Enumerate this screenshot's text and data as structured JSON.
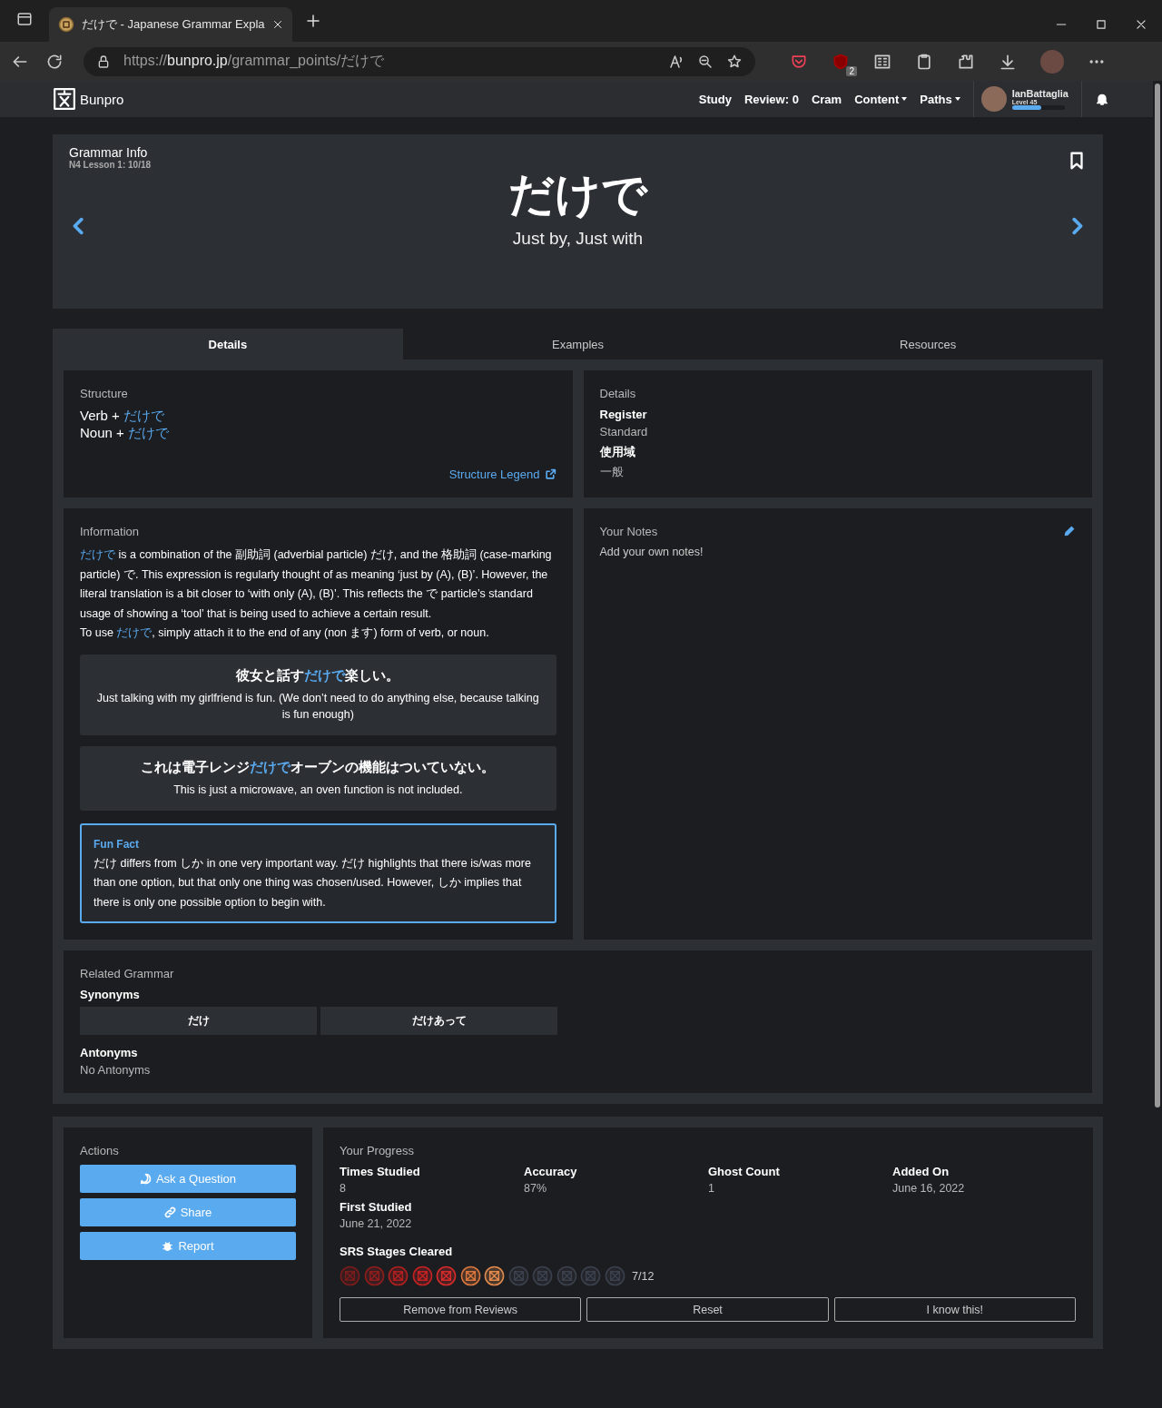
{
  "browser": {
    "tab_title": "だけで - Japanese Grammar Expla",
    "url_scheme": "https://",
    "url_host": "bunpro.jp",
    "url_path": "/grammar_points/だけで",
    "extension_badge": "2"
  },
  "nav": {
    "brand": "Bunpro",
    "items": [
      {
        "label": "Study",
        "dropdown": false
      },
      {
        "label": "Review: 0",
        "dropdown": false
      },
      {
        "label": "Cram",
        "dropdown": false
      },
      {
        "label": "Content",
        "dropdown": true
      },
      {
        "label": "Paths",
        "dropdown": true
      }
    ],
    "user": {
      "name": "IanBattaglia",
      "level_text": "Level 45",
      "level": 0.55
    }
  },
  "header": {
    "title": "Grammar Info",
    "lesson": "N4 Lesson 1: 10/18",
    "grammar": "だけで",
    "meaning": "Just by, Just with"
  },
  "tabs": [
    {
      "label": "Details",
      "selected": true
    },
    {
      "label": "Examples",
      "selected": false
    },
    {
      "label": "Resources",
      "selected": false
    }
  ],
  "structure": {
    "title": "Structure",
    "lines": [
      {
        "prefix": "Verb + ",
        "grammar": "だけで"
      },
      {
        "prefix": "Noun + ",
        "grammar": "だけで"
      }
    ],
    "legend_link": "Structure Legend"
  },
  "details": {
    "title": "Details",
    "items": [
      {
        "label": "Register",
        "value": "Standard"
      },
      {
        "label": "使用域",
        "value": "一般"
      }
    ]
  },
  "information": {
    "title": "Information",
    "paragraphs": [
      [
        {
          "text": "だけで",
          "highlight": true
        },
        {
          "text": " is a combination of the 副助詞 (adverbial particle) だけ, and the 格助詞 (case-marking particle) で. This expression is regularly thought of as meaning ‘just by (A), (B)’. However, the literal translation is a bit closer to ‘with only (A), (B)’. This reflects the で particle’s standard usage of showing a ‘tool’ that is being used to achieve a certain result.",
          "highlight": false
        }
      ],
      [
        {
          "text": "To use ",
          "highlight": false
        },
        {
          "text": "だけで",
          "highlight": true
        },
        {
          "text": ", simply attach it to the end of any (non ます) form of verb, or noun.",
          "highlight": false
        }
      ]
    ],
    "examples": [
      {
        "japanese": [
          {
            "text": "彼女と話す",
            "highlight": false
          },
          {
            "text": "だけで",
            "highlight": true
          },
          {
            "text": "楽しい。",
            "highlight": false
          }
        ],
        "english": "Just talking with my girlfriend is fun. (We don’t need to do anything else, because talking is fun enough)"
      },
      {
        "japanese": [
          {
            "text": "これは電子レンジ",
            "highlight": false
          },
          {
            "text": "だけで",
            "highlight": true
          },
          {
            "text": "オーブンの機能はついていない。",
            "highlight": false
          }
        ],
        "english": "This is just a microwave, an oven function is not included."
      }
    ],
    "fun_fact": {
      "title": "Fun Fact",
      "text": "だけ differs from しか in one very important way. だけ highlights that there is/was more than one option, but that only one thing was chosen/used. However, しか implies that there is only one possible option to begin with."
    }
  },
  "notes": {
    "title": "Your Notes",
    "placeholder": "Add your own notes!"
  },
  "related": {
    "title": "Related Grammar",
    "synonyms_label": "Synonyms",
    "synonyms": [
      "だけ",
      "だけあって"
    ],
    "antonyms_label": "Antonyms",
    "antonyms_text": "No Antonyms"
  },
  "actions": {
    "title": "Actions",
    "buttons": [
      {
        "label": "Ask a Question",
        "kind": "question"
      },
      {
        "label": "Share",
        "kind": "share"
      },
      {
        "label": "Report",
        "kind": "report"
      }
    ]
  },
  "progress": {
    "title": "Your Progress",
    "stats": [
      {
        "label": "Times Studied",
        "value": "8"
      },
      {
        "label": "Accuracy",
        "value": "87%"
      },
      {
        "label": "Ghost Count",
        "value": "1"
      },
      {
        "label": "Added On",
        "value": "June 16, 2022"
      },
      {
        "label": "First Studied",
        "value": "June 21, 2022"
      }
    ],
    "srs_label": "SRS Stages Cleared",
    "srs_stages": [
      {
        "color": "#7a1c1c"
      },
      {
        "color": "#8e1e1e"
      },
      {
        "color": "#b01f1f"
      },
      {
        "color": "#c42222"
      },
      {
        "color": "#d42a2a"
      },
      {
        "color": "#d8763e"
      },
      {
        "color": "#e08a4e"
      },
      {
        "color": "#3a414c"
      },
      {
        "color": "#3a414c"
      },
      {
        "color": "#3a414c"
      },
      {
        "color": "#3a414c"
      },
      {
        "color": "#3a414c"
      }
    ],
    "srs_count": "7/12",
    "buttons": [
      "Remove from Reviews",
      "Reset",
      "I know this!"
    ]
  }
}
